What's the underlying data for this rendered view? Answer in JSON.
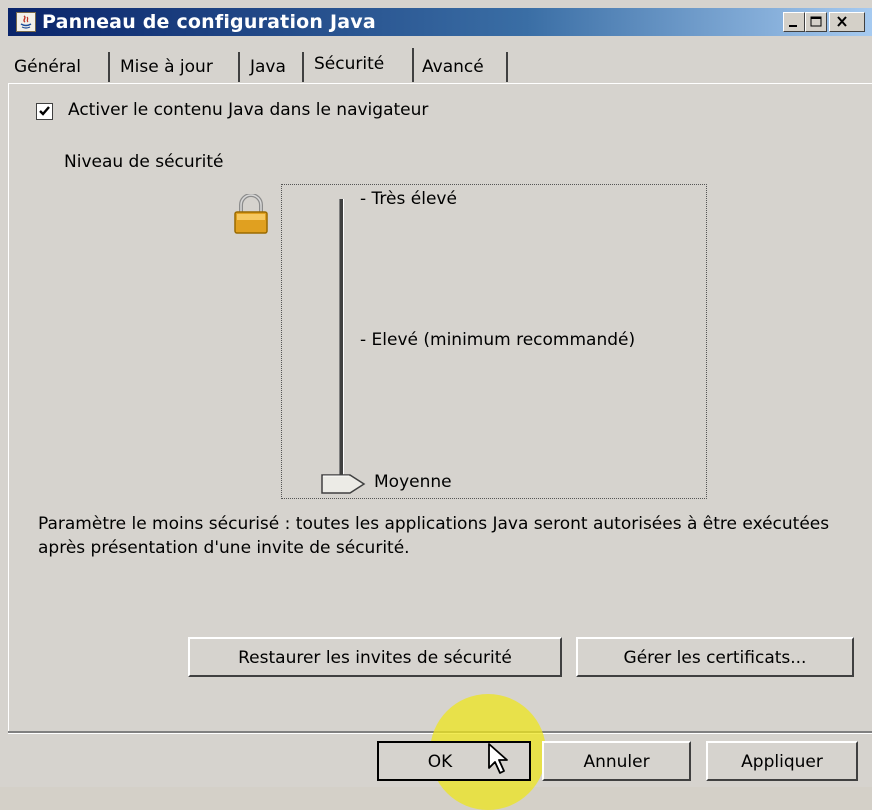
{
  "window": {
    "title": "Panneau de configuration Java",
    "icon": "java-icon",
    "controls": [
      "minimize-icon",
      "maximize-icon",
      "close-icon"
    ]
  },
  "tabs": [
    {
      "label": "Général",
      "selected": false
    },
    {
      "label": "Mise à jour",
      "selected": false
    },
    {
      "label": "Java",
      "selected": false
    },
    {
      "label": "Sécurité",
      "selected": true
    },
    {
      "label": "Avancé",
      "selected": false
    }
  ],
  "security": {
    "enable_checkbox": {
      "label": "Activer le contenu Java dans le navigateur",
      "checked": true
    },
    "level_label": "Niveau de sécurité",
    "levels": [
      "- Très élevé",
      "- Elevé (minimum recommandé)",
      "Moyenne"
    ],
    "selected_level": "Moyenne",
    "description": "Paramètre le moins sécurisé : toutes les applications Java seront autorisées à être exécutées après présentation d'une invite de sécurité.",
    "lock_icon": "padlock-icon"
  },
  "actions": {
    "restore_prompts": "Restaurer les invites de sécurité",
    "manage_certs": "Gérer les certificats..."
  },
  "footer": {
    "ok": "OK",
    "cancel": "Annuler",
    "apply": "Appliquer"
  },
  "colors": {
    "titlebar_start": "#0a246a",
    "titlebar_end": "#a6caf0",
    "face": "#d6d3ce",
    "highlight": "#eee61e"
  }
}
